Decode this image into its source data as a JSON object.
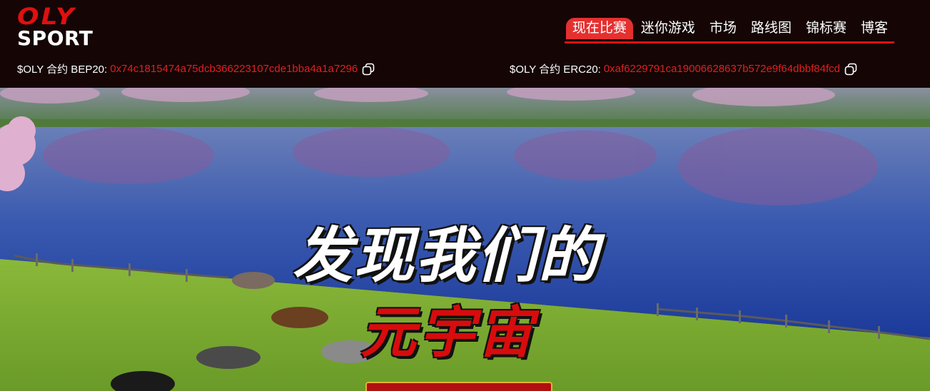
{
  "logo": {
    "line1": "OLY",
    "line2": "SPORT"
  },
  "nav": {
    "items": [
      {
        "label": "现在比赛",
        "active": true
      },
      {
        "label": "迷你游戏",
        "active": false
      },
      {
        "label": "市场",
        "active": false
      },
      {
        "label": "路线图",
        "active": false
      },
      {
        "label": "锦标赛",
        "active": false
      },
      {
        "label": "博客",
        "active": false
      }
    ]
  },
  "contracts": {
    "bep20": {
      "label": "$OLY 合约 BEP20:",
      "address": "0x74c1815474a75dcb366223107cde1bba4a1a7296"
    },
    "erc20": {
      "label": "$OLY 合约 ERC20:",
      "address": "0xaf6229791ca19006628637b572e9f64dbbf84fcd"
    }
  },
  "hero": {
    "headline_line1": "发现我们的",
    "headline_line2": "元宇宙"
  },
  "colors": {
    "brand_red": "#e01010",
    "header_bg": "#150505",
    "accent_gold": "#e8b030"
  },
  "icons": {
    "copy": "copy-icon"
  }
}
